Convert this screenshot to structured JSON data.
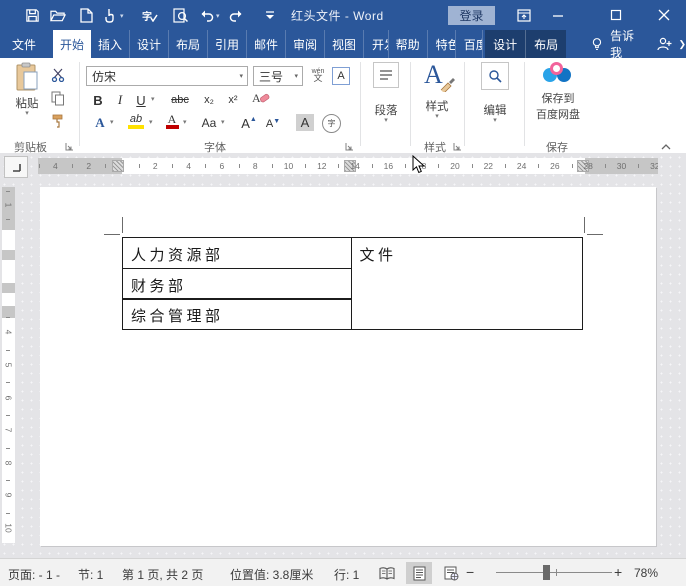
{
  "colors": {
    "accent": "#2b579a",
    "context_tab_bg": "#1d3e6e",
    "login_bg": "#9fb3d3",
    "highlight_yellow": "#ffe100",
    "font_color_red": "#c00000",
    "doc_bg": "#e4e4e7"
  },
  "title_bar": {
    "title": "红头文件 - Word",
    "login_label": "登录",
    "qat_icons": [
      "save",
      "open",
      "new",
      "touch-mouse-mode",
      "spell-check",
      "print-preview",
      "undo",
      "redo",
      "customize-quick-access"
    ]
  },
  "tab_bar": {
    "file": "文件",
    "tabs": [
      {
        "label": "开始",
        "active": true
      },
      {
        "label": "插入"
      },
      {
        "label": "设计"
      },
      {
        "label": "布局"
      },
      {
        "label": "引用"
      },
      {
        "label": "邮件"
      },
      {
        "label": "审阅"
      },
      {
        "label": "视图"
      },
      {
        "label": "开发工"
      },
      {
        "label": "帮助"
      },
      {
        "label": "特色功"
      },
      {
        "label": "百度网"
      }
    ],
    "context_design": "设计",
    "context_layout": "布局",
    "tell_me": "告诉我"
  },
  "ribbon": {
    "clipboard": {
      "paste_label": "粘贴",
      "group_label": "剪贴板"
    },
    "font": {
      "name": "仿宋",
      "size": "三号",
      "bold": "B",
      "italic": "I",
      "underline": "U",
      "strikethrough": "abc",
      "subscript": "x₂",
      "superscript": "x²",
      "phonetic_top": "wén",
      "phonetic_bottom": "文",
      "char_border": "A",
      "text_effects": "A",
      "highlight": "ab",
      "font_color": "A",
      "change_case": "Aa",
      "grow_font": "A",
      "shrink_font": "A",
      "char_shading": "A",
      "enclose_char": "字",
      "group_label": "字体"
    },
    "paragraph": {
      "label": "段落"
    },
    "styles": {
      "button_label": "样式",
      "group_label": "样式",
      "icon_letter": "A"
    },
    "editing": {
      "label": "编辑"
    },
    "baidu_save": {
      "line1": "保存到",
      "line2": "百度网盘",
      "group_label": "保存"
    }
  },
  "ruler": {
    "h_marks": [
      {
        "u": -4,
        "label": "4"
      },
      {
        "u": -2,
        "label": "2"
      },
      {
        "u": 2,
        "label": "2"
      },
      {
        "u": 4,
        "label": "4"
      },
      {
        "u": 6,
        "label": "6"
      },
      {
        "u": 8,
        "label": "8"
      },
      {
        "u": 10,
        "label": "10"
      },
      {
        "u": 12,
        "label": "12"
      },
      {
        "u": 14,
        "label": "14"
      },
      {
        "u": 16,
        "label": "16"
      },
      {
        "u": 18,
        "label": "18"
      },
      {
        "u": 20,
        "label": "20"
      },
      {
        "u": 22,
        "label": "22"
      },
      {
        "u": 24,
        "label": "24"
      },
      {
        "u": 26,
        "label": "26"
      },
      {
        "u": 28,
        "label": "28"
      },
      {
        "u": 30,
        "label": "30"
      },
      {
        "u": 32,
        "label": "32"
      }
    ],
    "v_top": "1",
    "v_marks": [
      {
        "cm": 4,
        "label": "4"
      },
      {
        "cm": 5,
        "label": "5"
      },
      {
        "cm": 6,
        "label": "6"
      },
      {
        "cm": 7,
        "label": "7"
      },
      {
        "cm": 8,
        "label": "8"
      },
      {
        "cm": 9,
        "label": "9"
      },
      {
        "cm": 10,
        "label": "10"
      }
    ]
  },
  "document": {
    "table": {
      "rows": [
        "人力资源部",
        "财务部",
        "综合管理部"
      ],
      "merged_cell": "文件"
    }
  },
  "status_bar": {
    "page_indicator": "页面: - 1 -",
    "section": "节: 1",
    "page_count": "第 1 页, 共 2 页",
    "position": "位置值: 3.8厘米",
    "line": "行: 1",
    "zoom_minus": "−",
    "zoom_plus": "+",
    "zoom_level": "78%"
  }
}
